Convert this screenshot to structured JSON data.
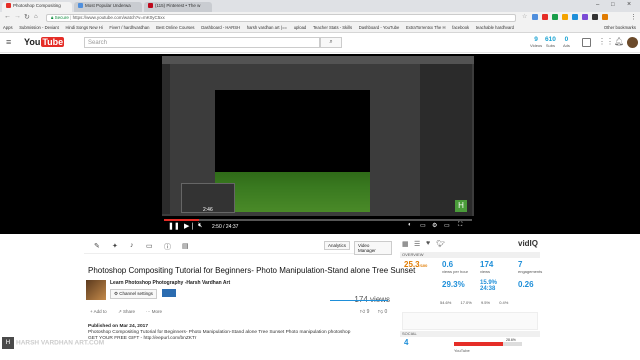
{
  "tabs": [
    {
      "label": "Photoshop Compositing"
    },
    {
      "label": "Most Popular Underwa"
    },
    {
      "label": "(115) Pinterest • The w"
    }
  ],
  "omnibox": {
    "secure_label": "Secure",
    "url": "https://www.youtube.com/watch?v=mK0yC5xx"
  },
  "bookmarks": [
    "Apps",
    "Submission - Deviant",
    "Hindi Songs New Hi",
    "Fiverr / hardhvardhan",
    "Best Online Courses",
    "Dashboard - HARSH",
    "harsh vardhan art (==",
    "upload",
    "Teacher Stats - Skills",
    "Dashboard - YouTube",
    "ExtraTorrentxx The H",
    "facebook",
    "teachable hardhvard",
    "Other bookmarks"
  ],
  "header": {
    "logo_text": "You",
    "logo_tube": "Tube",
    "search_placeholder": "Search",
    "stats": [
      {
        "value": "9",
        "label": "Videos"
      },
      {
        "value": "610",
        "label": "Subs"
      },
      {
        "value": "0",
        "label": "Ads"
      }
    ]
  },
  "player": {
    "preview_time": "2:46",
    "current_time": "2:50 / 24:37",
    "progress": 0.115
  },
  "toolbar": {
    "analytics_label": "Analytics",
    "video_manager_label": "Video Manager"
  },
  "video": {
    "title": "Photoshop Compositing Tutorial for Beginners- Photo Manipulation-Stand alone Tree Sunset",
    "channel": "Learn Photoshop Photography -Harsh Vardhan Art",
    "channel_settings": "Channel settings",
    "views": "174 views",
    "likes": "9",
    "dislikes": "0",
    "add_to": "Add to",
    "share": "Share",
    "more": "More",
    "published": "Published on Mar 24, 2017",
    "description": "Photoshop Compositing Tutorial for Beginners- Photo Manipulation-Stand alone Tree Sunset Photo manipulation photoshop",
    "gift": "GET YOUR FREE GIFT - http://eepurl.com/bnZKTr"
  },
  "vidiq": {
    "brand": "vidIQ",
    "overview_label": "OVERVIEW",
    "score": "25.3",
    "score_sub": "/100",
    "metrics": [
      {
        "value": "0.6",
        "label": "views per hour"
      },
      {
        "value": "174",
        "label": "views"
      },
      {
        "value": "7",
        "label": "engagements"
      }
    ],
    "row2": [
      {
        "value": "29.3%"
      },
      {
        "value": "15.9%"
      },
      {
        "value": "0.26"
      }
    ],
    "row2b": [
      "24:38"
    ],
    "pct": [
      "54.6%",
      "17.0%",
      "9.5%",
      "0.4%"
    ],
    "social_label": "SOCIAL",
    "social_value": "4",
    "youtube_label": "YouTube",
    "youtube_pct": "71.4%",
    "other_pct": "28.6%"
  },
  "watermark": {
    "initial": "H",
    "text": "HARSH VARDHAN ART.COM"
  },
  "colors": {
    "youtube_red": "#e52d27",
    "vidiq_blue": "#1f8fd9",
    "progress": "#e52d27"
  }
}
